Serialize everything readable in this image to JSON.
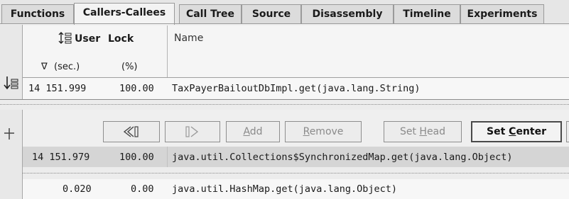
{
  "tabs": [
    "Functions",
    "Callers-Callees",
    "Call Tree",
    "Source",
    "Disassembly",
    "Timeline",
    "Experiments"
  ],
  "active_tab": "Callers-Callees",
  "header": {
    "metric_title_user": "User",
    "metric_title_lock": "Lock",
    "sort_arrow": "∇",
    "unit_sec": "(sec.)",
    "unit_pct": "(%)",
    "name_col": "Name"
  },
  "selected_function": {
    "time": "14 151.999",
    "percent": "100.00",
    "name": "TaxPayerBailoutDbImpl.get(java.lang.String)"
  },
  "toolbar": {
    "back_label": "◁▯",
    "forward_label": "▯▷",
    "add": {
      "accel": "A",
      "rest": "dd"
    },
    "remove": {
      "accel": "R",
      "rest": "emove"
    },
    "set_head": {
      "pre": "Set ",
      "accel": "H",
      "rest": "ead"
    },
    "set_center": {
      "pre": "Set ",
      "accel": "C",
      "rest": "enter"
    }
  },
  "center_row": {
    "time": "14 151.979",
    "percent": "100.00",
    "name": "java.util.Collections$SynchronizedMap.get(java.lang.Object)"
  },
  "callees": [
    {
      "time": "0.020",
      "percent": "0.00",
      "name": "java.util.HashMap.get(java.lang.Object)"
    }
  ],
  "colors": {
    "selected_row": "#d5d5d5",
    "header_bg": "#f5f5f5",
    "tab_bg": "#dcdcdc"
  }
}
